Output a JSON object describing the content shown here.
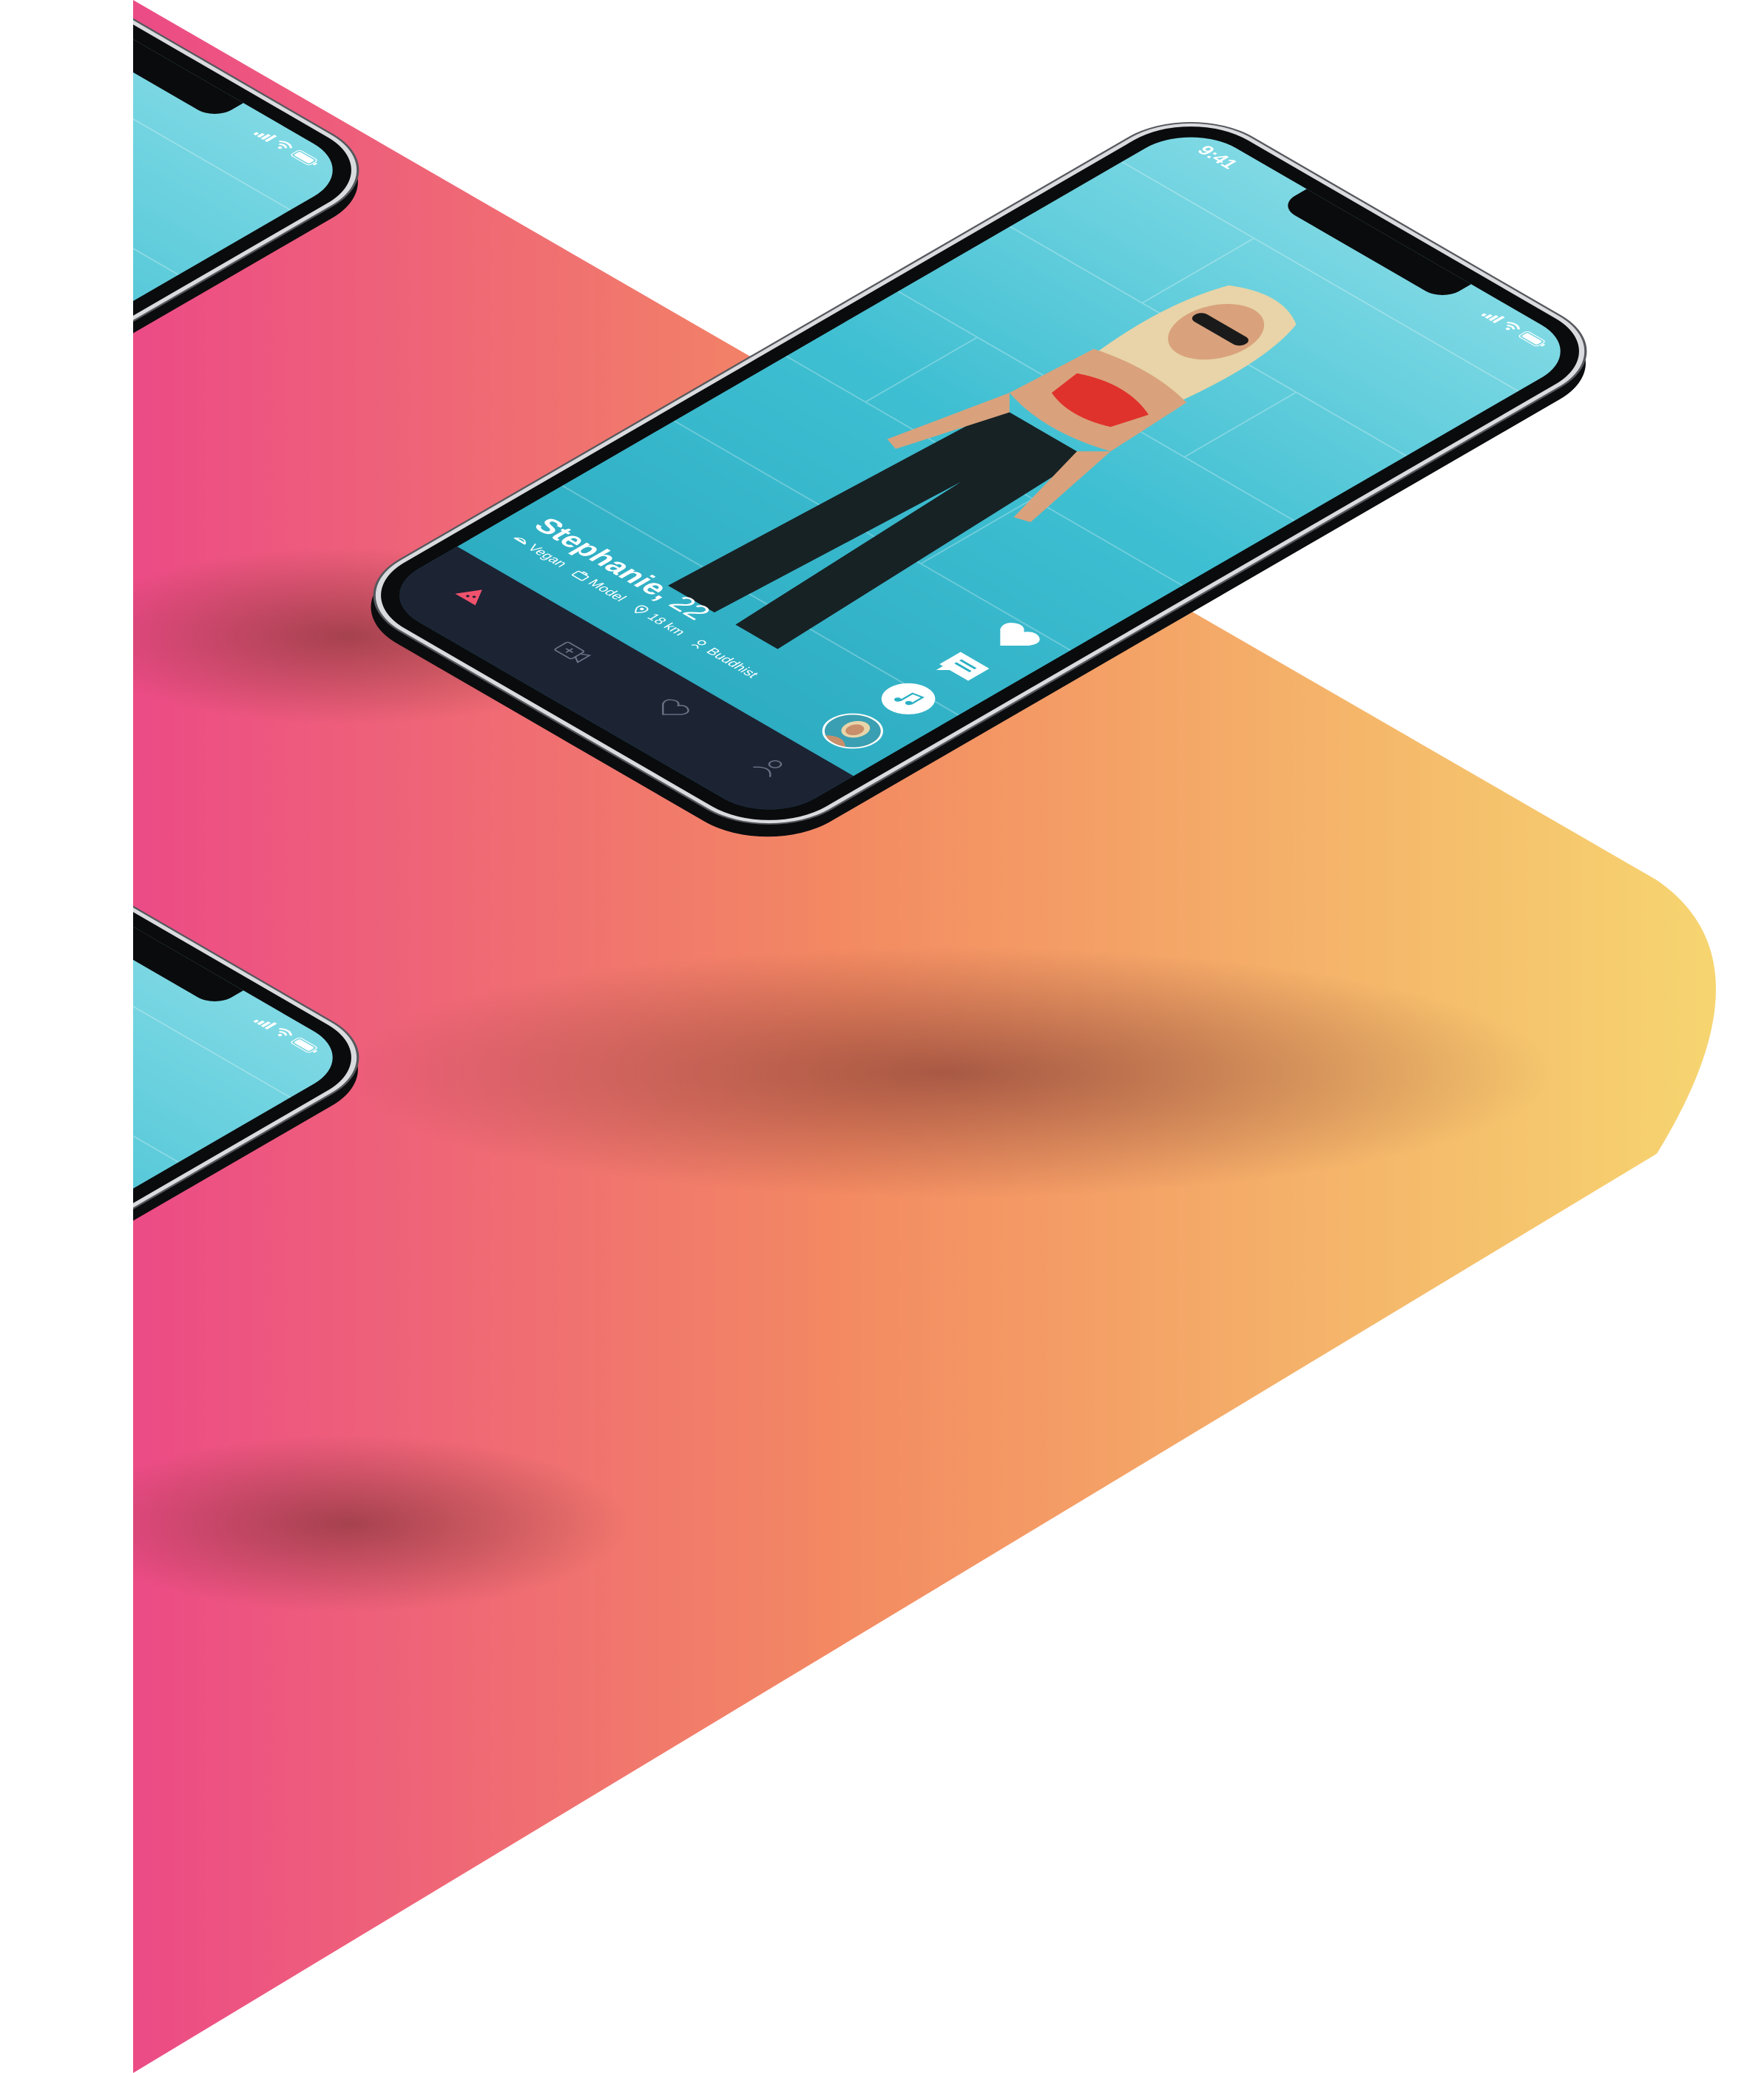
{
  "background": {
    "gradient_colors": [
      "#ec4b86",
      "#f38a62",
      "#f6d570"
    ]
  },
  "phones": [
    {
      "id": "phone-top-partial"
    },
    {
      "id": "phone-main"
    },
    {
      "id": "phone-bottom-partial"
    }
  ],
  "status_bar": {
    "time": "9:41",
    "icons": [
      "signal-icon",
      "wifi-icon",
      "battery-icon"
    ]
  },
  "profile": {
    "name": "Stephanie,",
    "age": "22",
    "distance": "18 km",
    "diet": "Vegan",
    "occupation": "Model",
    "religion": "Buddhist",
    "meta_icons": [
      "food-icon",
      "work-icon",
      "location-pin-icon",
      "religion-icon"
    ]
  },
  "actions": [
    "heart-icon",
    "message-icon",
    "music-icon",
    "avatar"
  ],
  "tab_bar": {
    "tabs": [
      "home-icon",
      "video-icon",
      "matches-icon",
      "profile-icon"
    ],
    "active_color": "#f0526d",
    "bg_color": "#1c2333"
  },
  "colors": {
    "accent": "#f0526d",
    "screen": "#3fbfd2",
    "icon_teal": "#2ab0c4"
  }
}
